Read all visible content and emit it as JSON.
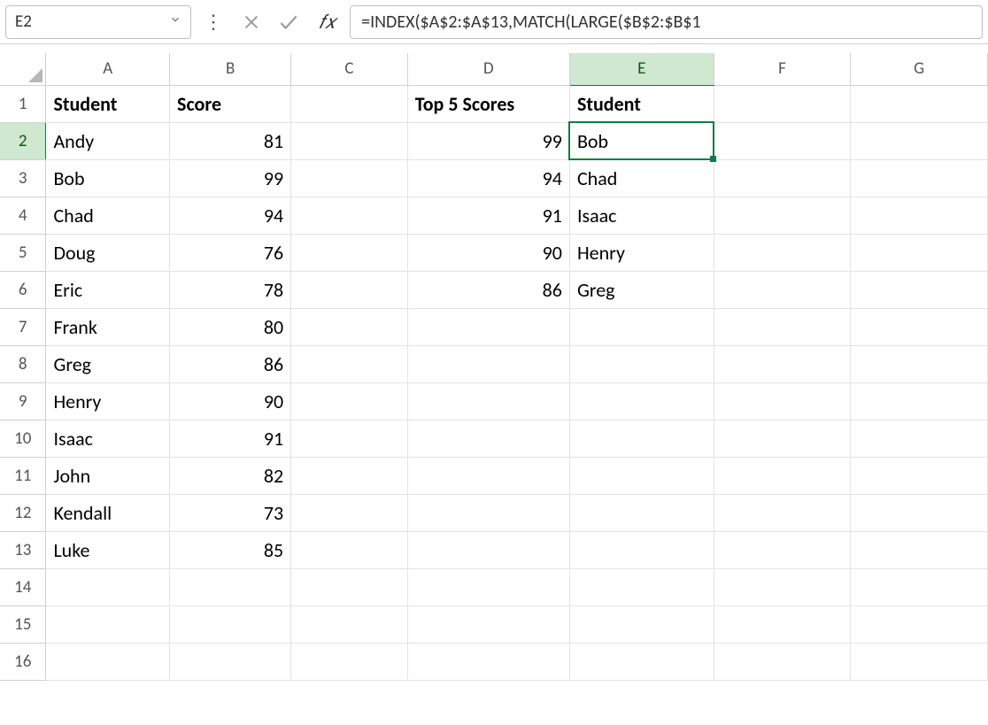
{
  "nameBox": "E2",
  "formula": "=INDEX($A$2:$A$13,MATCH(LARGE($B$2:$B$1",
  "columns": [
    "A",
    "B",
    "C",
    "D",
    "E",
    "F",
    "G"
  ],
  "activeColumn": "E",
  "activeRow": 2,
  "rowCount": 16,
  "headers": {
    "A1": "Student",
    "B1": "Score",
    "D1": "Top 5 Scores",
    "E1": "Student"
  },
  "table": {
    "rows": [
      {
        "name": "Andy",
        "score": 81
      },
      {
        "name": "Bob",
        "score": 99
      },
      {
        "name": "Chad",
        "score": 94
      },
      {
        "name": "Doug",
        "score": 76
      },
      {
        "name": "Eric",
        "score": 78
      },
      {
        "name": "Frank",
        "score": 80
      },
      {
        "name": "Greg",
        "score": 86
      },
      {
        "name": "Henry",
        "score": 90
      },
      {
        "name": "Isaac",
        "score": 91
      },
      {
        "name": "John",
        "score": 82
      },
      {
        "name": "Kendall",
        "score": 73
      },
      {
        "name": "Luke",
        "score": 85
      }
    ]
  },
  "top5": [
    {
      "score": 99,
      "name": "Bob"
    },
    {
      "score": 94,
      "name": "Chad"
    },
    {
      "score": 91,
      "name": "Isaac"
    },
    {
      "score": 90,
      "name": "Henry"
    },
    {
      "score": 86,
      "name": "Greg"
    }
  ]
}
